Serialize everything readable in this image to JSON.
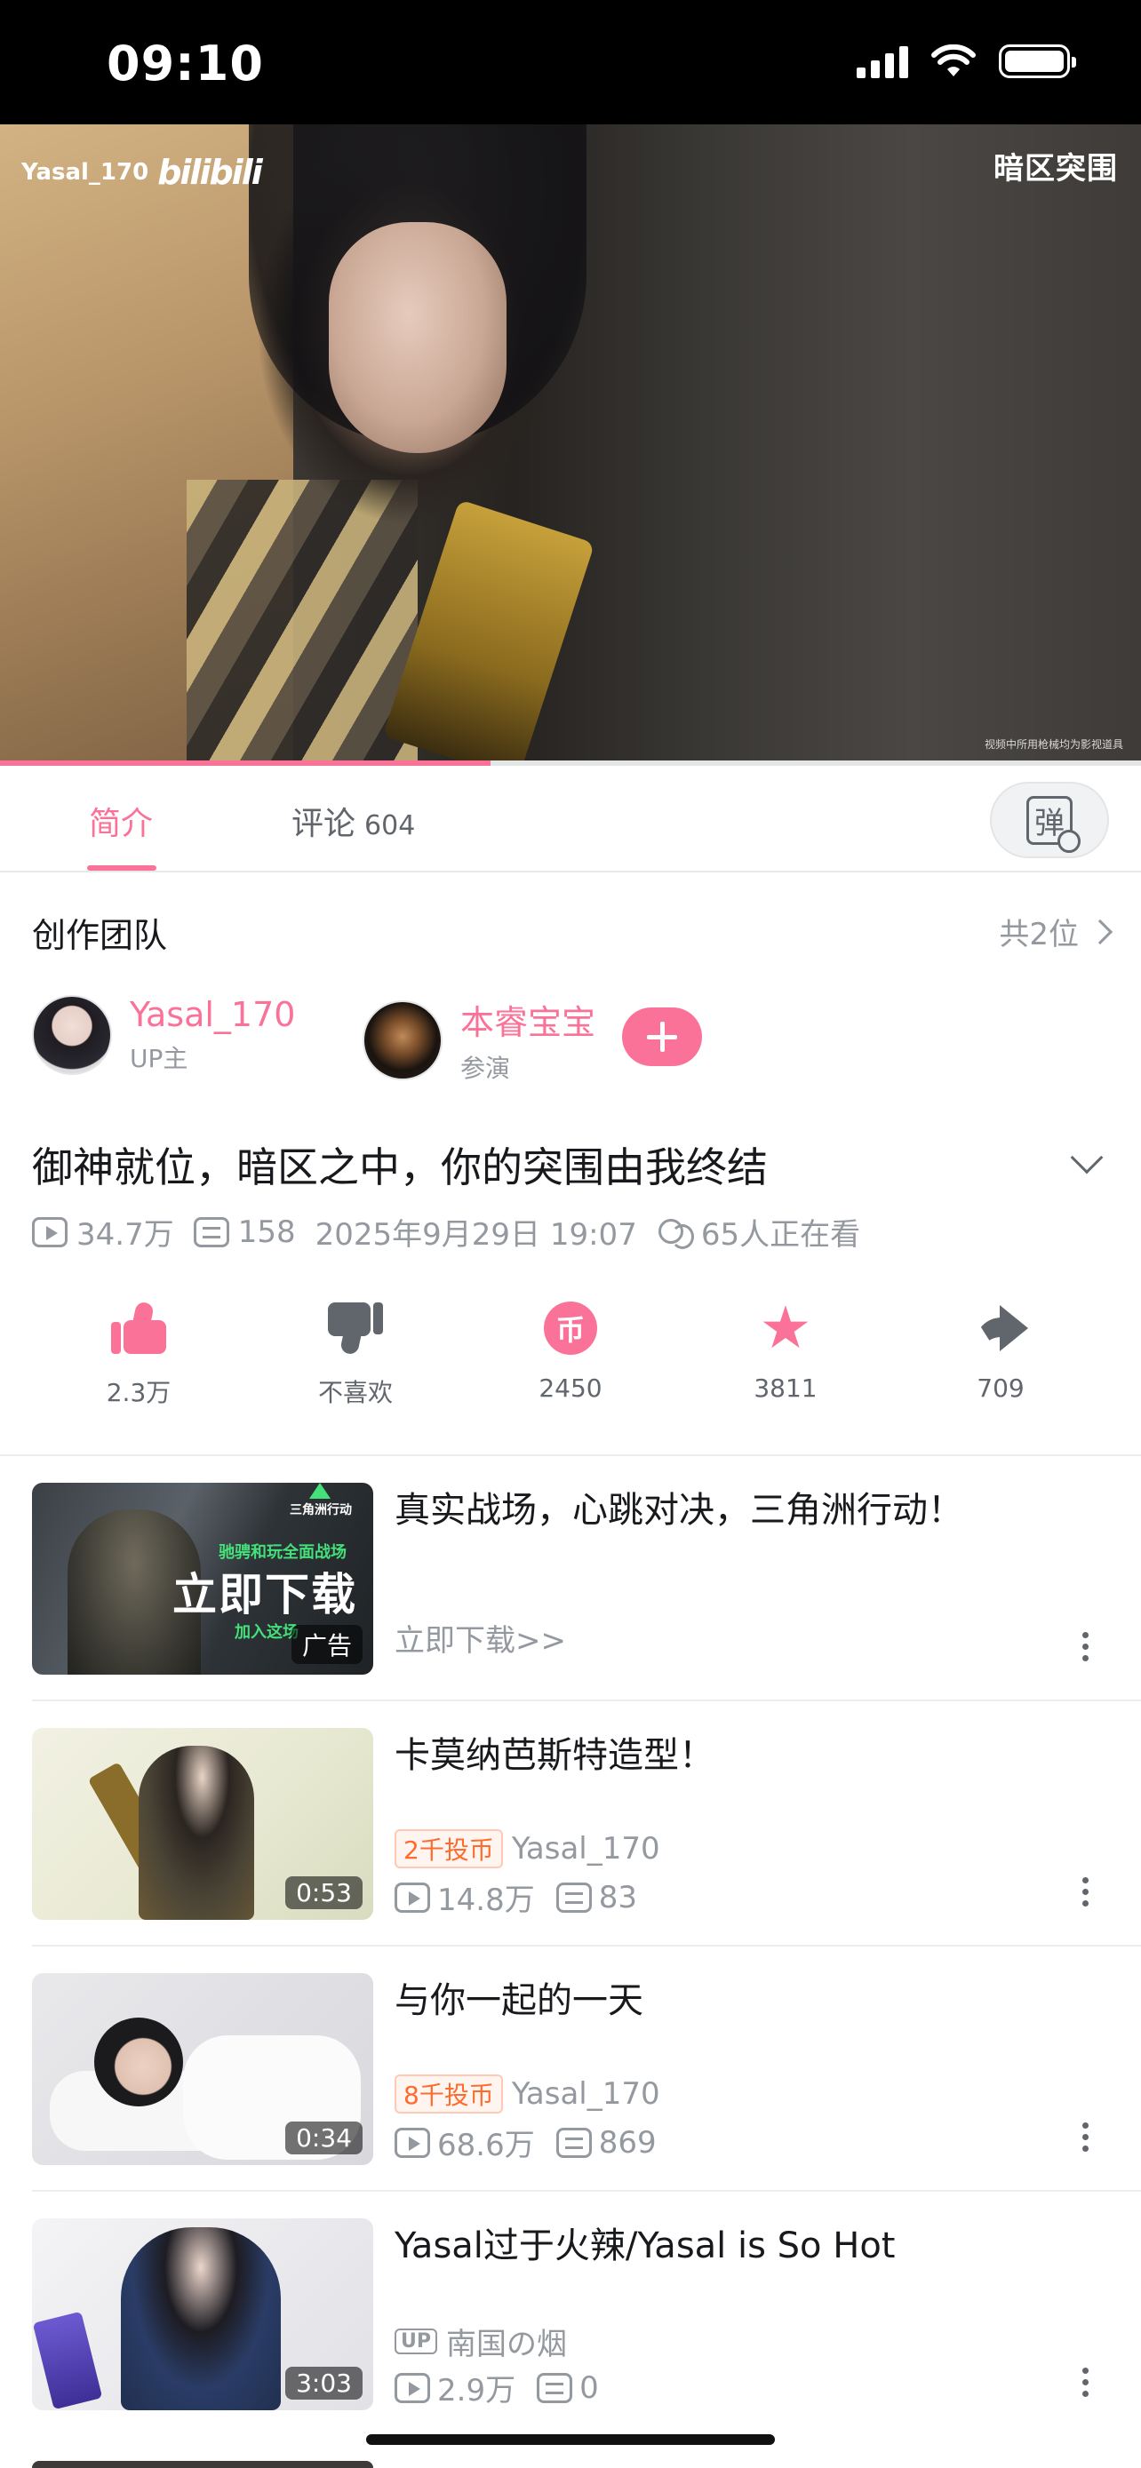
{
  "status_bar": {
    "time": "09:10"
  },
  "video": {
    "uploader_watermark": "Yasal_170",
    "platform_logo": "bilibili",
    "game_logo": "暗区突围",
    "disclaimer": "视频中所用枪械均为影视道具",
    "progress": 0.43
  },
  "tabs": {
    "intro_label": "简介",
    "comments_label": "评论",
    "comments_count": "604",
    "danmaku_icon": "弹"
  },
  "team": {
    "header": "创作团队",
    "count": "共2位",
    "members": [
      {
        "name": "Yasal_170",
        "role": "UP主"
      },
      {
        "name": "本睿宝宝",
        "role": "参演"
      }
    ],
    "follow_icon": "plus-icon"
  },
  "title": "御神就位，暗区之中，你的突围由我终结",
  "meta": {
    "views": "34.7万",
    "danmaku": "158",
    "date": "2025年9月29日 19:07",
    "watching": "65人正在看"
  },
  "actions": {
    "like": "2.3万",
    "dislike": "不喜欢",
    "coin": "2450",
    "coin_glyph": "币",
    "favorite": "3811",
    "share": "709"
  },
  "recommendations": [
    {
      "title": "真实战场，心跳对决，三角洲行动！",
      "sub": "立即下载>>",
      "thumb_badge": "广告",
      "thumb_text": "立即下载",
      "thumb_sub": "驰骋和玩全面战场",
      "thumb_sub2": "加入这场",
      "thumb_logo": "三角洲行动"
    },
    {
      "title": "卡莫纳芭斯特造型！",
      "duration": "0:53",
      "coin_badge": "2千投币",
      "author": "Yasal_170",
      "views": "14.8万",
      "danmaku": "83"
    },
    {
      "title": "与你一起的一天",
      "duration": "0:34",
      "coin_badge": "8千投币",
      "author": "Yasal_170",
      "views": "68.6万",
      "danmaku": "869"
    },
    {
      "title": "Yasal过于火辣/Yasal is  So Hot",
      "duration": "3:03",
      "up_badge": "UP",
      "author": "南国の烟",
      "views": "2.9万",
      "danmaku": "0"
    }
  ],
  "colors": {
    "accent": "#fb7299",
    "coin_badge": "#ff6b2c"
  }
}
